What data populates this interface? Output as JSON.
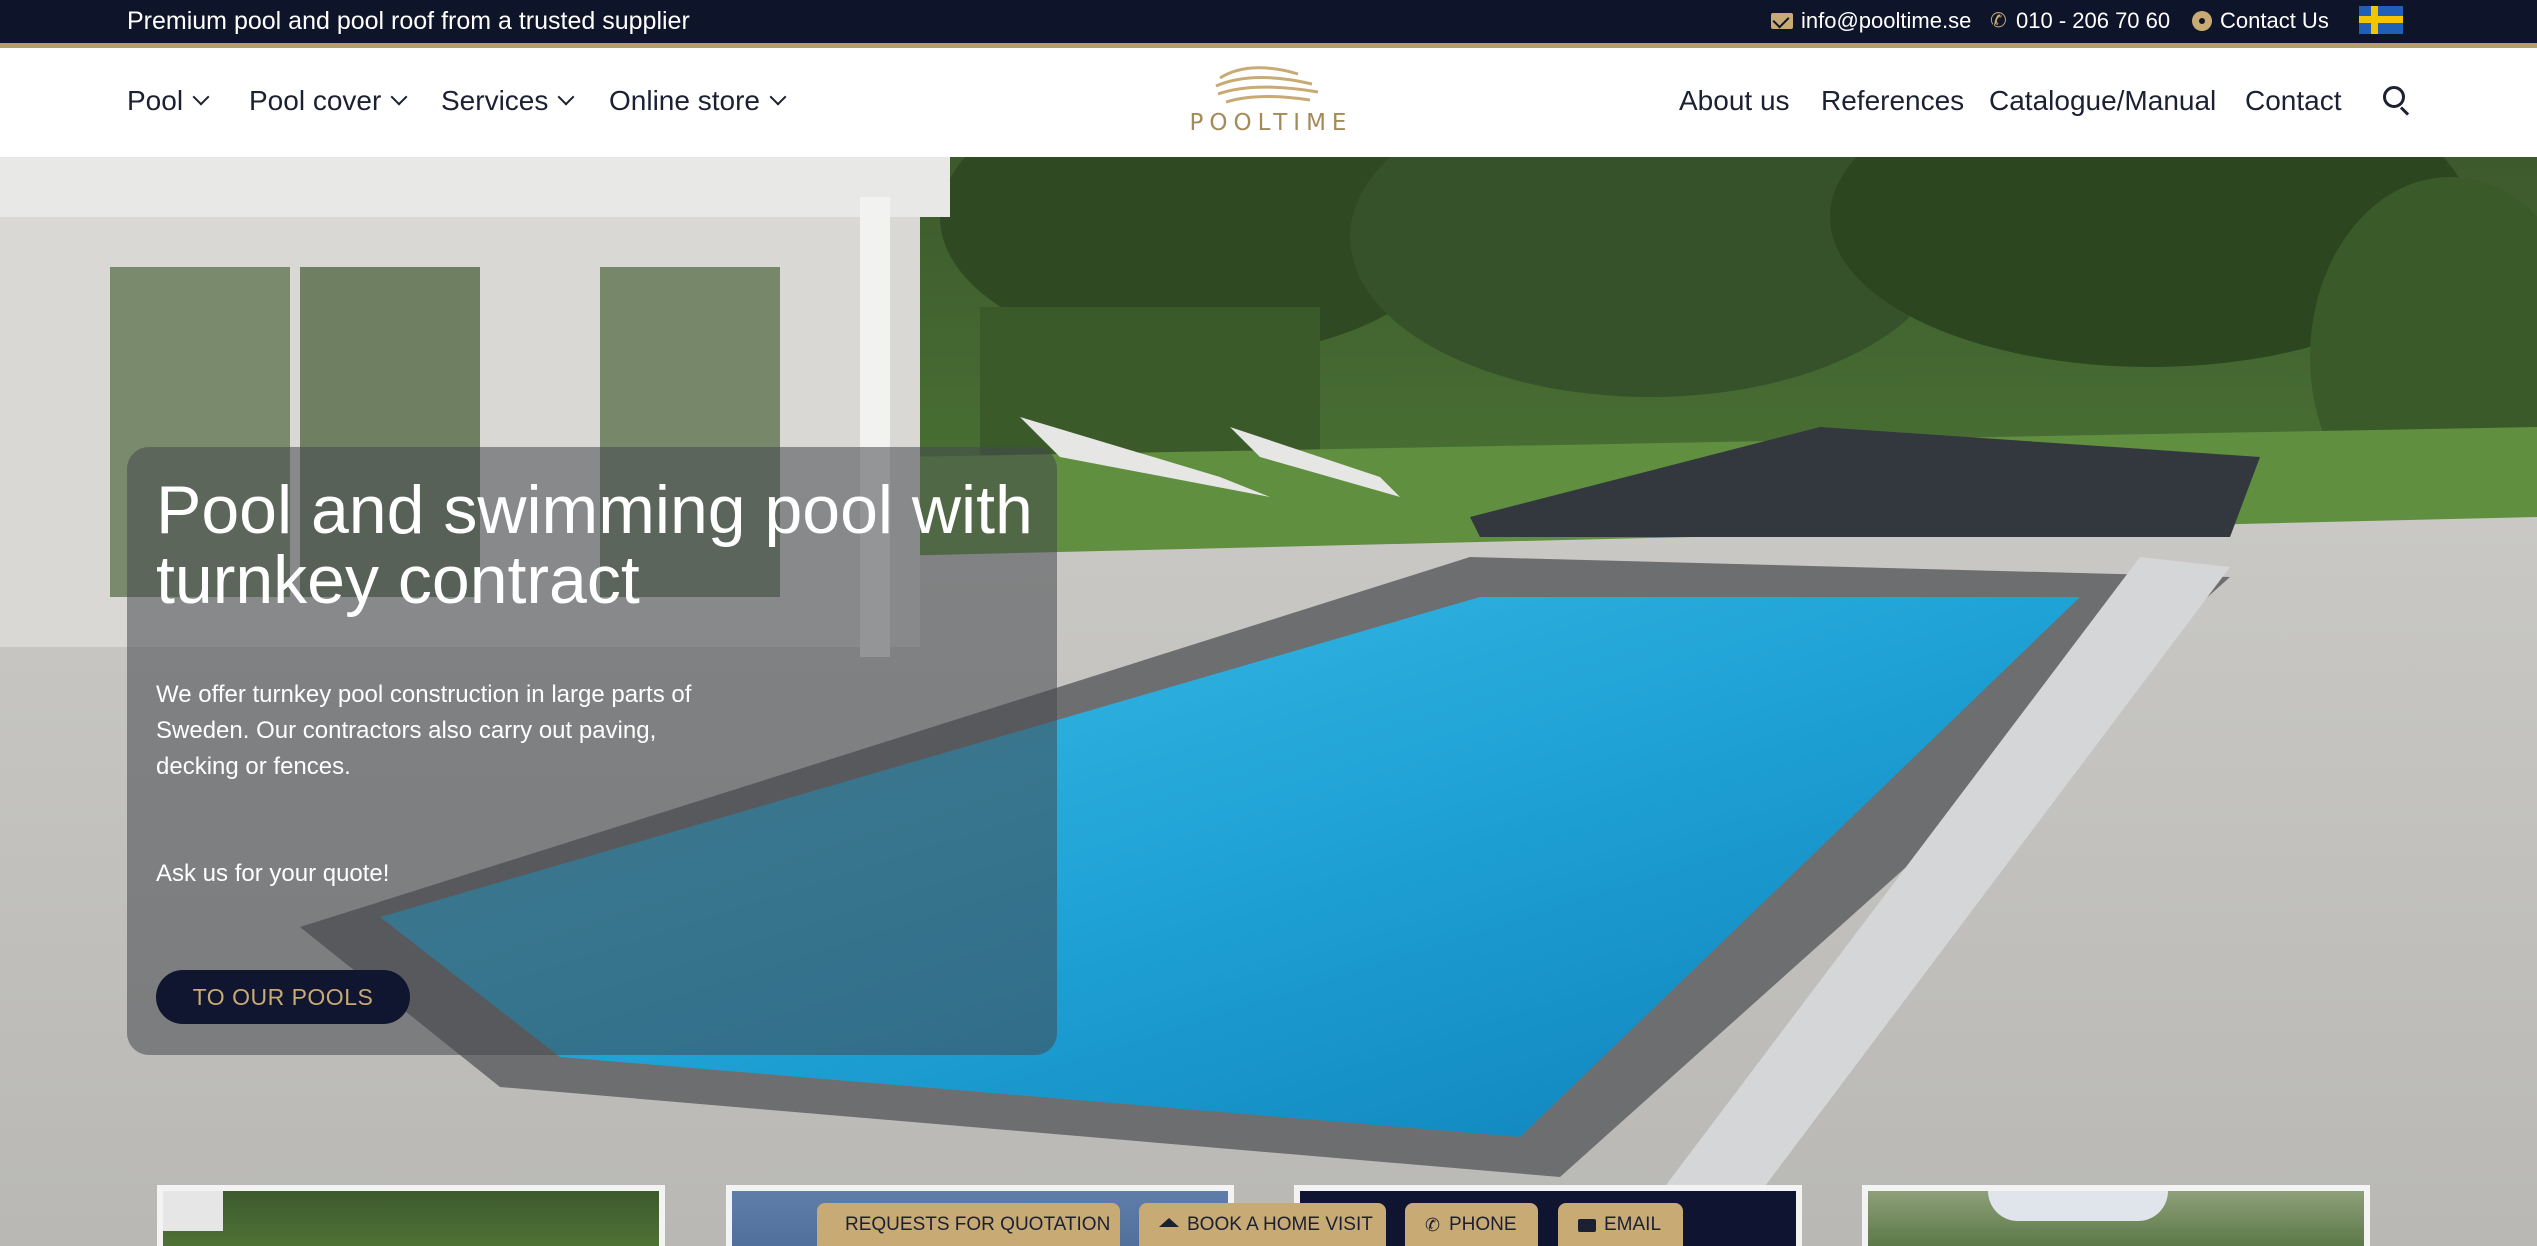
{
  "topbar": {
    "tagline": "Premium pool and pool roof from a trusted supplier",
    "email": "info@pooltime.se",
    "phone": "010 - 206 70 60",
    "contact": "Contact Us",
    "language_flag": "sweden-flag-icon",
    "background_color": "#0e1429",
    "accent_color": "#c8aa75"
  },
  "header": {
    "logo_text": "POOLTIME",
    "nav_left": [
      {
        "label": "Pool",
        "icon": "chevron-down-icon"
      },
      {
        "label": "Pool cover",
        "icon": "chevron-down-icon"
      },
      {
        "label": "Services",
        "icon": "chevron-down-icon"
      },
      {
        "label": "Online store",
        "icon": "chevron-down-icon"
      }
    ],
    "nav_right": [
      {
        "label": "About us"
      },
      {
        "label": "References"
      },
      {
        "label": "Catalogue/Manual"
      },
      {
        "label": "Contact"
      }
    ],
    "search_icon": "search-icon"
  },
  "hero": {
    "title": "Pool and swimming pool with turnkey contract",
    "text": "We offer turnkey pool construction in large parts of Sweden. Our contractors also carry out paving, decking or fences.",
    "cta_text": "Ask us for your quote!",
    "button_label": "TO OUR POOLS",
    "button_color": "#101530"
  },
  "fab": {
    "quote": "REQUESTS FOR QUOTATION",
    "visit": "BOOK A HOME VISIT",
    "phone": "PHONE",
    "email": "EMAIL",
    "color": "#c8aa75"
  }
}
